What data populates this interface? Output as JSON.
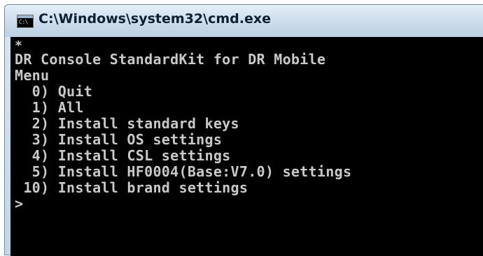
{
  "window": {
    "title": "C:\\Windows\\system32\\cmd.exe",
    "icon_label": "C:\\"
  },
  "console": {
    "lines": [
      "*",
      "DR Console StandardKit for DR Mobile",
      "Menu",
      "  0) Quit",
      "  1) All",
      "  2) Install standard keys",
      "  3) Install OS settings",
      "  4) Install CSL settings",
      "  5) Install HF0004(Base:V7.0) settings",
      " 10) Install brand settings",
      ">"
    ]
  }
}
